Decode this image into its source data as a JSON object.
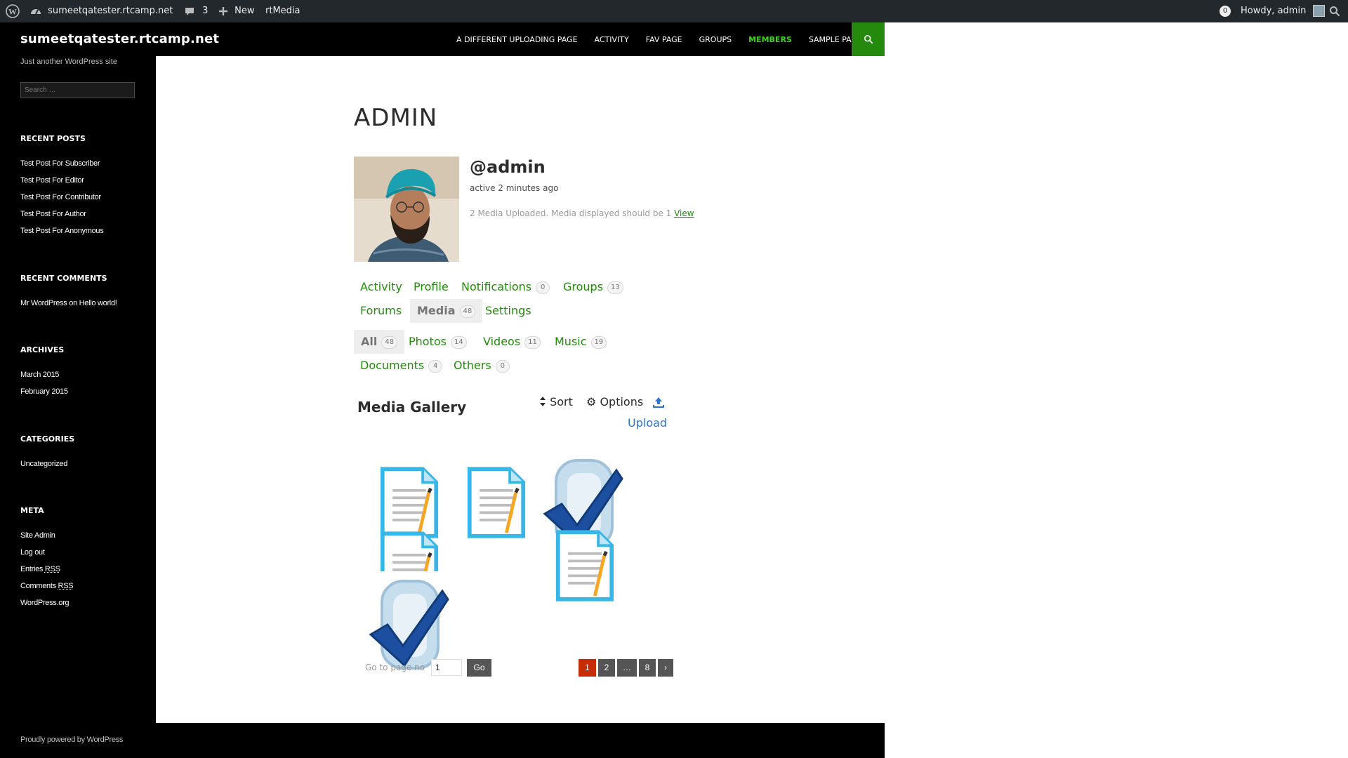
{
  "adminbar": {
    "site_name": "sumeetqatester.rtcamp.net",
    "comments_count": "3",
    "new_label": "New",
    "plugin_label": "rtMedia",
    "notif_count": "0",
    "howdy": "Howdy, admin"
  },
  "header": {
    "site_title": "sumeetqatester.rtcamp.net",
    "site_description": "Just another WordPress site",
    "nav": [
      "A DIFFERENT UPLOADING PAGE",
      "ACTIVITY",
      "FAV PAGE",
      "GROUPS",
      "MEMBERS",
      "SAMPLE PAGE"
    ],
    "current_nav": "MEMBERS"
  },
  "sidebar": {
    "search_placeholder": "Search …",
    "recent_posts_title": "RECENT POSTS",
    "recent_posts": [
      "Test Post For Subscriber",
      "Test Post For Editor",
      "Test Post For Contributor",
      "Test Post For Author",
      "Test Post For Anonymous"
    ],
    "recent_comments_title": "RECENT COMMENTS",
    "comment_author": "Mr WordPress",
    "comment_on": "on",
    "comment_post": "Hello world!",
    "archives_title": "ARCHIVES",
    "archives": [
      "March 2015",
      "February 2015"
    ],
    "categories_title": "CATEGORIES",
    "categories": [
      "Uncategorized"
    ],
    "meta_title": "META",
    "meta": {
      "site_admin": "Site Admin",
      "log_out": "Log out",
      "entries_prefix": "Entries",
      "comments_prefix": "Comments",
      "rss": "RSS",
      "wordpress_org": "WordPress.org"
    }
  },
  "profile": {
    "page_title": "ADMIN",
    "username": "@admin",
    "active": "active 2 minutes ago",
    "media_note": "2 Media Uploaded. Media displayed should be 1",
    "view_link": "View"
  },
  "member_tabs": {
    "activity": "Activity",
    "profile": "Profile",
    "notifications": "Notifications",
    "notifications_count": "0",
    "groups": "Groups",
    "groups_count": "13",
    "forums": "Forums",
    "media": "Media",
    "media_count": "48",
    "settings": "Settings"
  },
  "media_tabs": {
    "all": "All",
    "all_count": "48",
    "photos": "Photos",
    "photos_count": "14",
    "videos": "Videos",
    "videos_count": "11",
    "music": "Music",
    "music_count": "19",
    "documents": "Documents",
    "documents_count": "4",
    "others": "Others",
    "others_count": "0"
  },
  "gallery": {
    "title": "Media Gallery",
    "sort": "Sort",
    "options": "Options",
    "upload": "Upload",
    "items": [
      {
        "kind": "document-icon"
      },
      {
        "kind": "document-icon"
      },
      {
        "kind": "checkmark-icon"
      },
      {
        "kind": "document-icon"
      },
      {
        "kind": "document-icon"
      },
      {
        "kind": "checkmark-icon"
      }
    ]
  },
  "pagination": {
    "goto_label": "Go to page no",
    "goto_value": "1",
    "go_button": "Go",
    "pages": [
      "1",
      "2",
      "…",
      "8",
      "›"
    ],
    "current": "1"
  },
  "footer": {
    "credit": "Proudly powered by WordPress"
  },
  "colors": {
    "accent_green": "#24890d",
    "nav_current": "#41d41b",
    "pagination_current": "#c62d05",
    "upload_blue": "#2b75d0"
  }
}
